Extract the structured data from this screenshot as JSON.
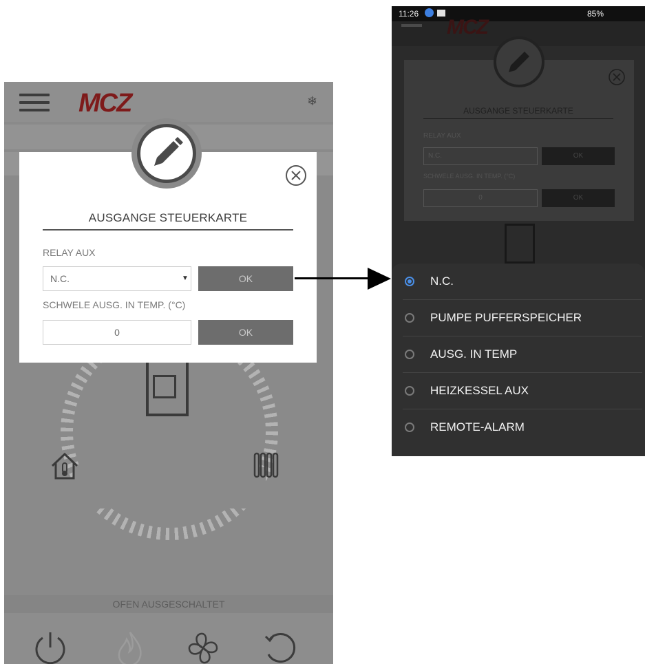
{
  "left": {
    "logo": "MCZ",
    "modal": {
      "title": "AUSGANGE STEUERKARTE",
      "relay_label": "RELAY AUX",
      "relay_value": "N.C.",
      "ok_label": "OK",
      "threshold_label": "SCHWELE AUSG. IN TEMP. (°C)",
      "threshold_value": "0",
      "ok_label_2": "OK"
    },
    "status_text": "OFEN AUSGESCHALTET"
  },
  "right": {
    "status_bar": {
      "time": "11:26",
      "right": "85%"
    },
    "logo": "MCZ",
    "modal": {
      "title": "AUSGANGE STEUERKARTE",
      "relay_label": "RELAY AUX",
      "relay_value": "N.C.",
      "ok_label": "OK",
      "threshold_label": "SCHWELE AUSG. IN TEMP. (°C)",
      "threshold_value": "0",
      "ok_label_2": "OK"
    },
    "options": [
      {
        "label": "N.C.",
        "selected": true
      },
      {
        "label": "PUMPE PUFFERSPEICHER",
        "selected": false
      },
      {
        "label": "AUSG. IN TEMP",
        "selected": false
      },
      {
        "label": "HEIZKESSEL AUX",
        "selected": false
      },
      {
        "label": "REMOTE-ALARM",
        "selected": false
      }
    ]
  },
  "colors": {
    "accent": "#4a8fe7",
    "brand": "#7e1a1a"
  }
}
